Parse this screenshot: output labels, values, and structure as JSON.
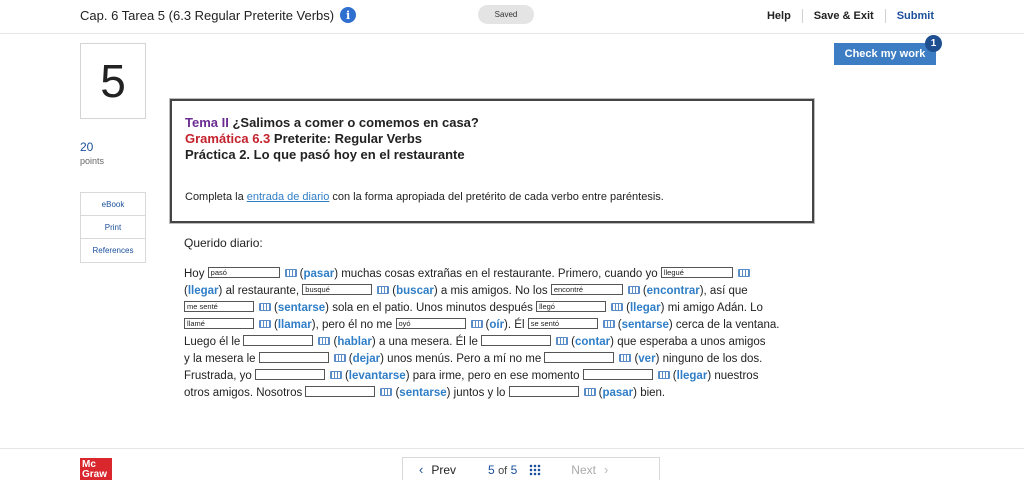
{
  "header": {
    "assignment_title": "Cap. 6 Tarea 5 (6.3 Regular Preterite Verbs)",
    "saved_status": "Saved",
    "help": "Help",
    "save_exit": "Save & Exit",
    "submit": "Submit"
  },
  "check_work": {
    "label": "Check my work",
    "badge": "1"
  },
  "question": {
    "number": "5",
    "points": "20",
    "points_label": "points"
  },
  "sidebar": {
    "items": [
      "eBook",
      "Print",
      "References"
    ]
  },
  "instructions": {
    "tema_label": "Tema II",
    "tema_text": "¿Salimos a comer o comemos en casa?",
    "gramatica_label": "Gramática 6.3",
    "gramatica_text": "Preterite: Regular Verbs",
    "practica": "Práctica 2. Lo que pasó hoy en el restaurante",
    "text_before": "Completa la",
    "link": "entrada de diario",
    "text_after": "con la forma apropiada del pretérito de cada verbo entre paréntesis."
  },
  "passage": {
    "greeting": "Querido diario:",
    "t1": "Hoy",
    "b1": "pasó",
    "v1": "pasar",
    "t2": "muchas cosas extrañas en el restaurante. Primero, cuando yo",
    "b2": "llegué",
    "v2": "llegar",
    "t3": "al restaurante,",
    "b3": "busqué",
    "v3": "buscar",
    "t4": "a mis amigos. No los",
    "b4": "encontré",
    "v4": "encontrar",
    "t5": ", así que",
    "b5": "me senté",
    "v5": "sentarse",
    "t6": "sola en el patio. Unos minutos después",
    "b6": "llegó",
    "v6": "llegar",
    "t7": "mi amigo Adán. Lo",
    "b7": "llamé",
    "v7": "llamar",
    "t8": ", pero él no me",
    "b8": "oyó",
    "v8": "oír",
    "t9": ". Él",
    "b9": "se sentó",
    "v9": "sentarse",
    "t10": "cerca de la ventana.",
    "t11": "Luego él le",
    "b10": "",
    "v10": "hablar",
    "t12": "a una mesera. Él le",
    "b11": "",
    "v11": "contar",
    "t13": "que esperaba a unos amigos",
    "t14": "y la mesera le",
    "b12": "",
    "v12": "dejar",
    "t15": "unos menús. Pero a mí no me",
    "b13": "",
    "v13": "ver",
    "t16": "ninguno de los dos.",
    "t17": "Frustrada, yo",
    "b14": "",
    "v14": "levantarse",
    "t18": "para irme, pero en ese momento",
    "b15": "",
    "v15": "llegar",
    "t19": "nuestros",
    "t20": "otros amigos. Nosotros",
    "b16": "",
    "v16": "sentarse",
    "t21": "juntos y lo",
    "b17": "",
    "v17": "pasar",
    "t22": "bien."
  },
  "footer": {
    "logo_line1": "Mc",
    "logo_line2": "Graw",
    "prev": "Prev",
    "current_page": "5",
    "of": "of",
    "total_pages": "5",
    "next": "Next"
  }
}
